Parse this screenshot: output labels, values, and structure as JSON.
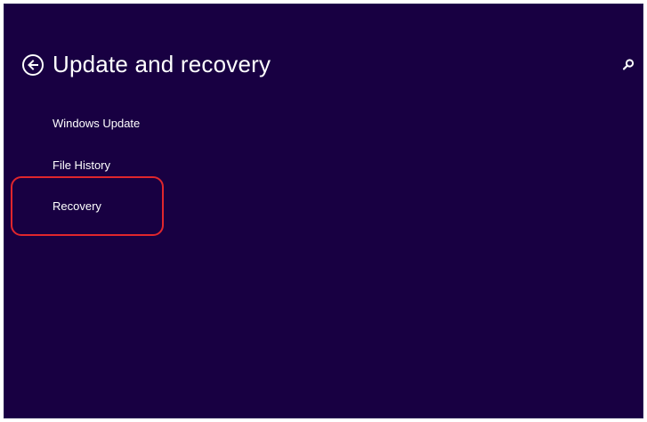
{
  "header": {
    "title": "Update and recovery",
    "back_icon": "back-arrow-circle-icon",
    "search_icon": "search-icon"
  },
  "nav": {
    "items": [
      {
        "label": "Windows Update"
      },
      {
        "label": "File History"
      },
      {
        "label": "Recovery"
      }
    ]
  },
  "colors": {
    "background": "#180042",
    "text": "#ffffff",
    "highlight": "#e0262d"
  }
}
